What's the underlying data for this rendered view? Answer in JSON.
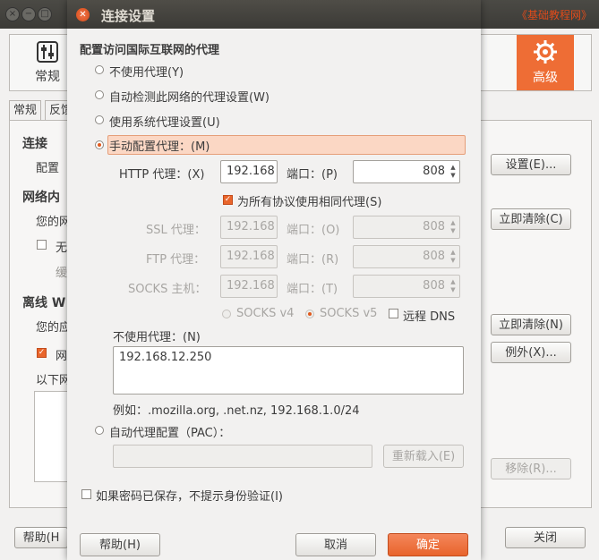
{
  "watermark": "《基础教程网》",
  "background_window": {
    "toolbar": {
      "general_label": "常规",
      "advanced_label": "高级"
    },
    "tabs": [
      "常规",
      "反馈"
    ],
    "sections": {
      "connection_head": "连接",
      "connection_sub": "配置",
      "network_head": "网络内",
      "network_sub": "您的网",
      "check1_label": "无",
      "cache_sub": "缓",
      "offline_head": "离线 W",
      "offline_sub": "您的应",
      "check2_label": "网",
      "list_sub": "以下网"
    },
    "buttons": {
      "settings": "设置(E)...",
      "clear_now_1": "立即清除(C)",
      "clear_now_2": "立即清除(N)",
      "exceptions": "例外(X)...",
      "remove": "移除(R)...",
      "help": "帮助(H",
      "close": "关闭"
    }
  },
  "dialog": {
    "title": "连接设置",
    "heading": "配置访问国际互联网的代理",
    "options": {
      "no_proxy": "不使用代理(Y)",
      "auto_detect": "自动检测此网络的代理设置(W)",
      "system_proxy": "使用系统代理设置(U)",
      "manual": "手动配置代理：(M)",
      "auto_config": "自动代理配置（PAC）："
    },
    "http": {
      "label": "HTTP 代理：(X)",
      "host": "192.168",
      "port_label": "端口：(P)",
      "port": "808"
    },
    "same_proxy_label": "为所有协议使用相同代理(S)",
    "ssl": {
      "label": "SSL 代理：",
      "host": "192.168",
      "port_label": "端口：(O)",
      "port": "808"
    },
    "ftp": {
      "label": "FTP 代理：",
      "host": "192.168",
      "port_label": "端口：(R)",
      "port": "808"
    },
    "socks": {
      "label": "SOCKS 主机：",
      "host": "192.168",
      "port_label": "端口：(T)",
      "port": "808"
    },
    "socks_v4": "SOCKS v4",
    "socks_v5": "SOCKS v5",
    "remote_dns": "远程 DNS",
    "no_proxy_for_label": "不使用代理：(N)",
    "no_proxy_for_value": "192.168.12.250",
    "example": "例如：.mozilla.org, .net.nz, 192.168.1.0/24",
    "pac_url": "",
    "reload_label": "重新载入(E)",
    "no_prompt_label": "如果密码已保存，不提示身份验证(I)",
    "help_label": "帮助(H)",
    "cancel_label": "取消",
    "ok_label": "确定"
  },
  "colors": {
    "accent": "#e9652b",
    "titlebar": "#3c3b37",
    "watermark": "#e04b1a"
  },
  "icons": {
    "general": "toggle-switches-icon",
    "advanced": "gear-icon",
    "close": "close-icon"
  }
}
